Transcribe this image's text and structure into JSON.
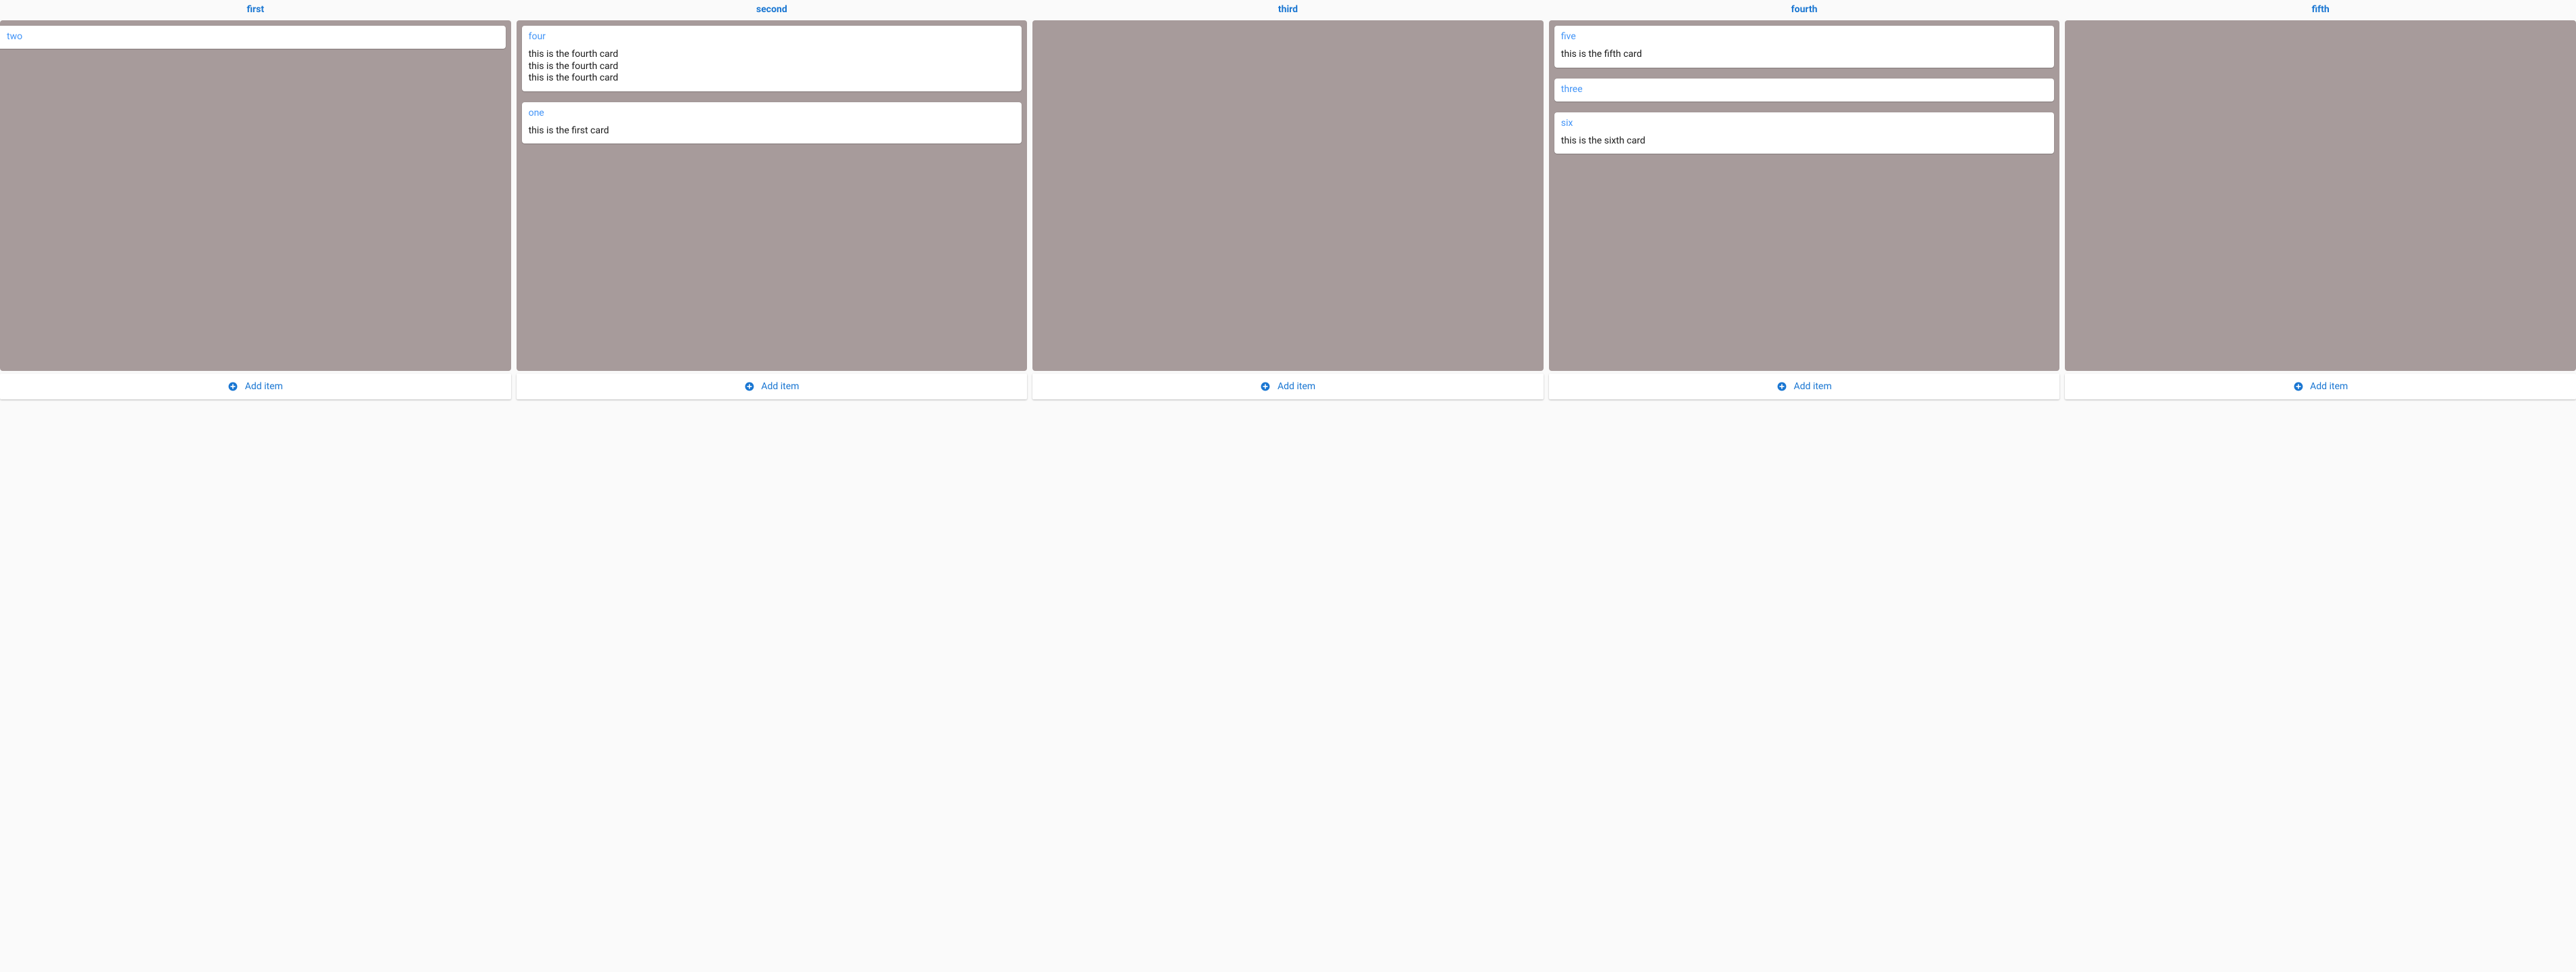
{
  "add_item_label": "Add item",
  "columns": [
    {
      "title": "first",
      "cards": [
        {
          "title": "two",
          "body": ""
        }
      ]
    },
    {
      "title": "second",
      "cards": [
        {
          "title": "four",
          "body": "this is the fourth card\nthis is the fourth card\nthis is the fourth card"
        },
        {
          "title": "one",
          "body": "this is the first card"
        }
      ]
    },
    {
      "title": "third",
      "cards": []
    },
    {
      "title": "fourth",
      "cards": [
        {
          "title": "five",
          "body": "this is the fifth card"
        },
        {
          "title": "three",
          "body": ""
        },
        {
          "title": "six",
          "body": "this is the sixth card"
        }
      ]
    },
    {
      "title": "fifth",
      "cards": []
    }
  ]
}
